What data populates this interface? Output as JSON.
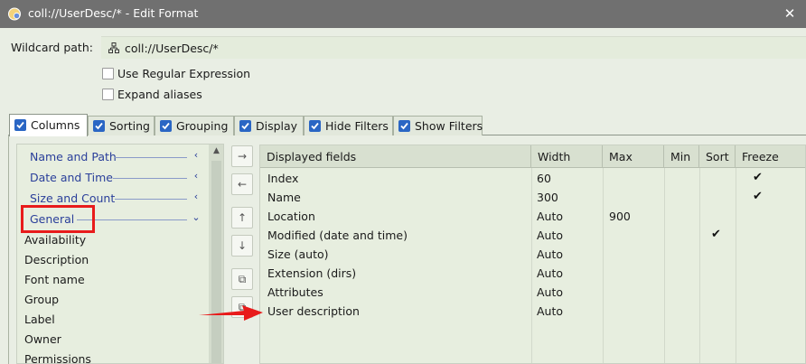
{
  "window": {
    "title": "coll://UserDesc/* - Edit Format",
    "close_glyph": "✕",
    "icon": "app-folder-icon"
  },
  "wildcard": {
    "label": "Wildcard path:",
    "value": "coll://UserDesc/*",
    "icon": "collection-icon"
  },
  "options": {
    "regex_label": "Use Regular Expression",
    "regex_checked": false,
    "aliases_label": "Expand aliases",
    "aliases_checked": false
  },
  "tabs": [
    {
      "label": "Columns",
      "checked": true,
      "active": true
    },
    {
      "label": "Sorting",
      "checked": true,
      "active": false
    },
    {
      "label": "Grouping",
      "checked": true,
      "active": false
    },
    {
      "label": "Display",
      "checked": true,
      "active": false
    },
    {
      "label": "Hide Filters",
      "checked": true,
      "active": false
    },
    {
      "label": "Show Filters",
      "checked": true,
      "active": false
    }
  ],
  "left_list": {
    "groups": [
      {
        "label": "Name and Path",
        "chevron": "‹",
        "expanded": false
      },
      {
        "label": "Date and Time",
        "chevron": "‹",
        "expanded": false
      },
      {
        "label": "Size and Count",
        "chevron": "‹",
        "expanded": false
      },
      {
        "label": "General",
        "chevron": "⌄",
        "expanded": true
      }
    ],
    "items": [
      "Availability",
      "Description",
      "Font name",
      "Group",
      "Label",
      "Owner",
      "Permissions"
    ]
  },
  "mid_buttons": [
    {
      "name": "add-field-button",
      "glyph": "→"
    },
    {
      "name": "remove-field-button",
      "glyph": "←"
    },
    {
      "name": "move-up-button",
      "glyph": "↑"
    },
    {
      "name": "move-down-button",
      "glyph": "↓"
    },
    {
      "name": "copy-button",
      "glyph": "⧉"
    },
    {
      "name": "paste-button",
      "glyph": "⧉"
    }
  ],
  "grid": {
    "headers": [
      "Displayed fields",
      "Width",
      "Max",
      "Min",
      "Sort",
      "Freeze"
    ],
    "rows": [
      {
        "field": "Index",
        "width": "60",
        "max": "",
        "min": "",
        "sort": false,
        "freeze": true
      },
      {
        "field": "Name",
        "width": "300",
        "max": "",
        "min": "",
        "sort": false,
        "freeze": true
      },
      {
        "field": "Location",
        "width": "Auto",
        "max": "900",
        "min": "",
        "sort": false,
        "freeze": false
      },
      {
        "field": "Modified (date and time)",
        "width": "Auto",
        "max": "",
        "min": "",
        "sort": true,
        "freeze": false
      },
      {
        "field": "Size (auto)",
        "width": "Auto",
        "max": "",
        "min": "",
        "sort": false,
        "freeze": false
      },
      {
        "field": "Extension (dirs)",
        "width": "Auto",
        "max": "",
        "min": "",
        "sort": false,
        "freeze": false
      },
      {
        "field": "Attributes",
        "width": "Auto",
        "max": "",
        "min": "",
        "sort": false,
        "freeze": false
      },
      {
        "field": "User description",
        "width": "Auto",
        "max": "",
        "min": "",
        "sort": false,
        "freeze": false
      }
    ]
  },
  "annotation": {
    "highlight_color": "#e81b1b",
    "arrow_color": "#e81b1b"
  }
}
